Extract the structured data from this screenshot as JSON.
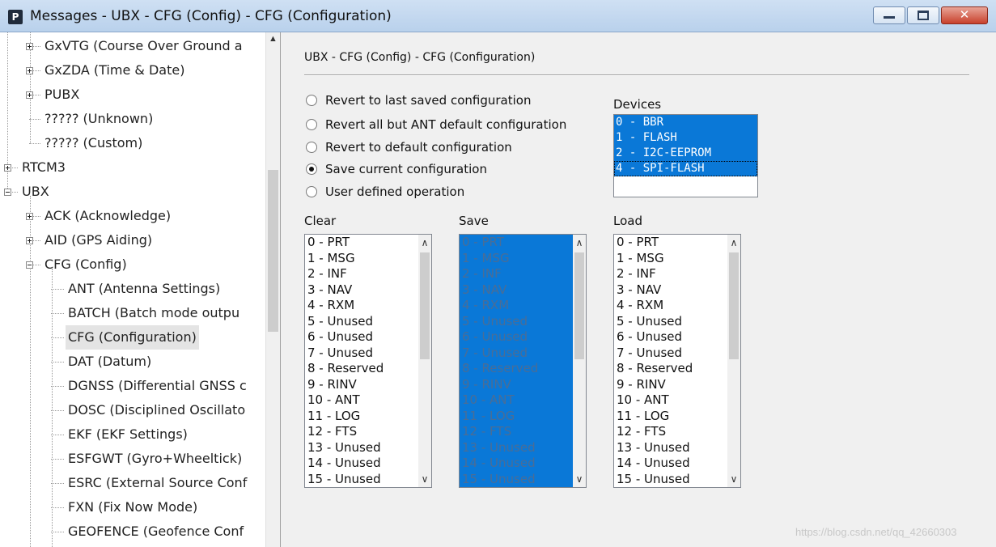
{
  "window": {
    "title": "Messages - UBX - CFG (Config) - CFG (Configuration)",
    "icon_letter": "P"
  },
  "tree": {
    "rows": [
      {
        "label": "GxVTG (Course Over Ground a",
        "expander": "plus"
      },
      {
        "label": "GxZDA (Time & Date)",
        "expander": "plus"
      },
      {
        "label": "PUBX",
        "expander": "plus"
      },
      {
        "label": "????? (Unknown)",
        "expander": "none"
      },
      {
        "label": "????? (Custom)",
        "expander": "none"
      },
      {
        "label": "RTCM3",
        "expander": "plus"
      },
      {
        "label": "UBX",
        "expander": "minus"
      },
      {
        "label": "ACK (Acknowledge)",
        "expander": "plus"
      },
      {
        "label": "AID (GPS Aiding)",
        "expander": "plus"
      },
      {
        "label": "CFG (Config)",
        "expander": "minus"
      },
      {
        "label": "ANT (Antenna Settings)",
        "expander": "none"
      },
      {
        "label": "BATCH (Batch mode outpu",
        "expander": "none"
      },
      {
        "label": "CFG (Configuration)",
        "expander": "none",
        "selected": true
      },
      {
        "label": "DAT (Datum)",
        "expander": "none"
      },
      {
        "label": "DGNSS (Differential GNSS c",
        "expander": "none"
      },
      {
        "label": "DOSC (Disciplined Oscillato",
        "expander": "none"
      },
      {
        "label": "EKF (EKF Settings)",
        "expander": "none"
      },
      {
        "label": "ESFGWT (Gyro+Wheeltick)",
        "expander": "none"
      },
      {
        "label": "ESRC (External Source Conf",
        "expander": "none"
      },
      {
        "label": "FXN (Fix Now Mode)",
        "expander": "none"
      },
      {
        "label": "GEOFENCE (Geofence Conf",
        "expander": "none"
      }
    ]
  },
  "panel": {
    "title": "UBX - CFG (Config) - CFG (Configuration)",
    "options": [
      {
        "label": "Revert to last saved configuration",
        "checked": false
      },
      {
        "label": "Revert all but ANT default configuration",
        "checked": false
      },
      {
        "label": "Revert to default configuration",
        "checked": false
      },
      {
        "label": "Save current configuration",
        "checked": true
      },
      {
        "label": "User defined operation",
        "checked": false
      }
    ],
    "devices_label": "Devices",
    "devices": [
      "0 - BBR",
      "1 - FLASH",
      "2 - I2C-EEPROM",
      "4 - SPI-FLASH"
    ],
    "clear_label": "Clear",
    "save_label": "Save",
    "load_label": "Load",
    "items": [
      "0 - PRT",
      "1 - MSG",
      "2 - INF",
      "3 - NAV",
      "4 - RXM",
      "5 - Unused",
      "6 - Unused",
      "7 - Unused",
      "8 - Reserved",
      "9 - RINV",
      "10 - ANT",
      "11 - LOG",
      "12 - FTS",
      "13 - Unused",
      "14 - Unused",
      "15 - Unused"
    ]
  },
  "watermark": "https://blog.csdn.net/qq_42660303",
  "colors": {
    "selection": "#0a78d7",
    "titlebar": "#b9d1ec"
  }
}
